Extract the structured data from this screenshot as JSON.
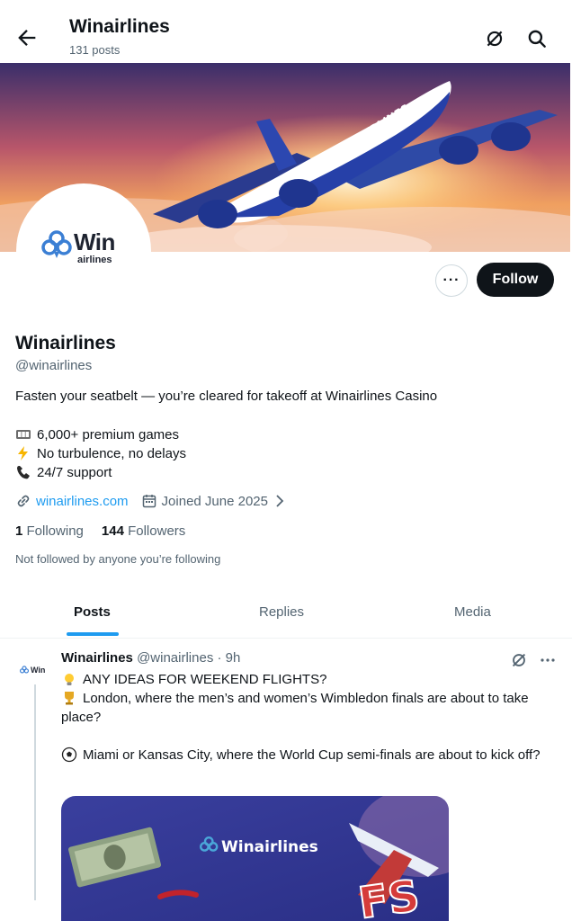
{
  "header": {
    "title": "Winairlines",
    "posts_count": "131 posts",
    "icons": [
      "back-arrow-icon",
      "grok-icon",
      "search-icon"
    ]
  },
  "banner": {
    "plane_text": "WINAIRLINES"
  },
  "avatar": {
    "logo_word": "Win",
    "logo_sub": "airlines"
  },
  "actions": {
    "more_label": "···",
    "follow_label": "Follow"
  },
  "profile": {
    "name": "Winairlines",
    "handle": "@winairlines",
    "bio": "Fasten your seatbelt — you’re cleared for takeoff at Winairlines Casino",
    "bio_lines": [
      {
        "emoji": "slot-machine-icon",
        "text": "6,000+ premium games"
      },
      {
        "emoji": "lightning-icon",
        "text": "No turbulence, no delays"
      },
      {
        "emoji": "phone-icon",
        "text": "24/7 support"
      }
    ],
    "website": "winairlines.com",
    "joined": "Joined June 2025",
    "following_count": "1",
    "following_label": "Following",
    "followers_count": "144",
    "followers_label": "Followers",
    "not_followed": "Not followed by anyone you’re following"
  },
  "tabs": [
    {
      "label": "Posts",
      "active": true
    },
    {
      "label": "Replies",
      "active": false
    },
    {
      "label": "Media",
      "active": false
    }
  ],
  "post": {
    "author": "Winairlines",
    "handle": "@winairlines",
    "separator": "·",
    "time": "9h",
    "avatar_text": "Win",
    "line1": "ANY IDEAS FOR WEEKEND FLIGHTS?",
    "line2": "London, where the men’s and women’s Wimbledon finals are about to take place?",
    "line3": "Miami or Kansas City, where the World Cup semi-finals are about to kick off?",
    "image_brand": "Winairlines",
    "image_badge": "FS"
  },
  "colors": {
    "accent": "#1d9bf0",
    "text": "#0f1419",
    "muted": "#536471",
    "follow_bg": "#0f1419"
  }
}
